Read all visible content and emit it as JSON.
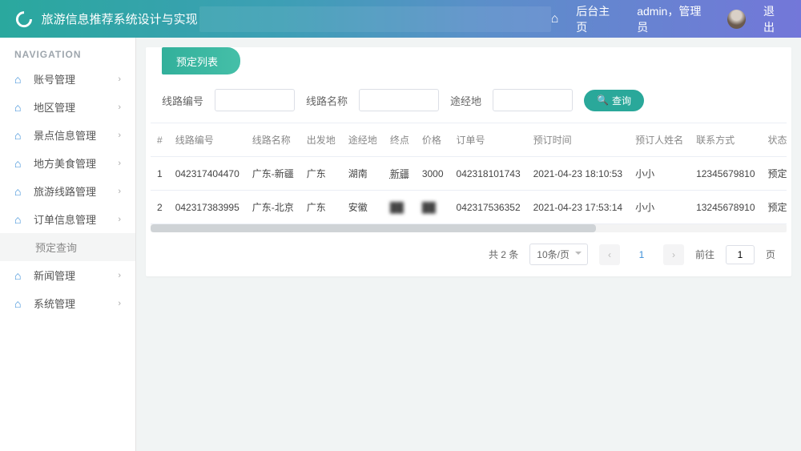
{
  "header": {
    "app_title": "旅游信息推荐系统设计与实现",
    "home_label": "后台主页",
    "user_info": "admin，管理员",
    "logout_label": "退出"
  },
  "sidebar": {
    "nav_header": "NAVIGATION",
    "items": [
      {
        "label": "账号管理"
      },
      {
        "label": "地区管理"
      },
      {
        "label": "景点信息管理"
      },
      {
        "label": "地方美食管理"
      },
      {
        "label": "旅游线路管理"
      },
      {
        "label": "订单信息管理"
      },
      {
        "label": "新闻管理"
      },
      {
        "label": "系统管理"
      }
    ],
    "sub_active": "预定查询"
  },
  "panel": {
    "title": "预定列表"
  },
  "filters": {
    "route_code_label": "线路编号",
    "route_name_label": "线路名称",
    "via_label": "途经地",
    "search_btn": "查询"
  },
  "table": {
    "headers": [
      "#",
      "线路编号",
      "线路名称",
      "出发地",
      "途经地",
      "终点",
      "价格",
      "订单号",
      "预订时间",
      "预订人姓名",
      "联系方式",
      "状态"
    ],
    "rows": [
      {
        "idx": "1",
        "code": "042317404470",
        "name": "广东-新疆",
        "from": "广东",
        "via": "湖南",
        "end": "新疆",
        "price": "3000",
        "order": "042318101743",
        "time": "2021-04-23 18:10:53",
        "person": "小小",
        "contact": "12345679810",
        "status": "预定成功"
      },
      {
        "idx": "2",
        "code": "042317383995",
        "name": "广东-北京",
        "from": "广东",
        "via": "安徽",
        "end": "██",
        "price": "██",
        "order": "042317536352",
        "time": "2021-04-23 17:53:14",
        "person": "小小",
        "contact": "13245678910",
        "status": "预定成功"
      }
    ]
  },
  "pagination": {
    "total_text": "共 2 条",
    "per_page": "10条/页",
    "current": "1",
    "goto_prefix": "前往",
    "goto_suffix": "页",
    "goto_value": "1"
  }
}
